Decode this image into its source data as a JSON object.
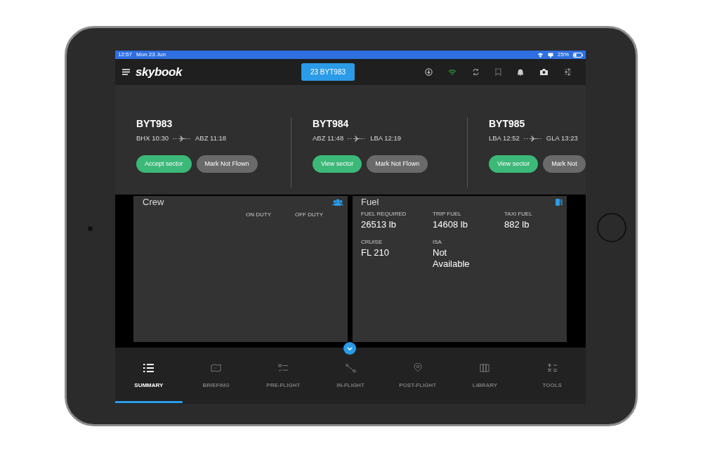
{
  "status_bar": {
    "time": "12:57",
    "date": "Mon 23 Jun",
    "battery": "25%"
  },
  "header": {
    "logo": "skybook",
    "flight_button": "23 BYT983"
  },
  "sectors": [
    {
      "flight": "BYT983",
      "from": "BHX 10:30",
      "to": "ABZ 11:18",
      "primary_button": "Accept sector",
      "secondary_button": "Mark Not Flown"
    },
    {
      "flight": "BYT984",
      "from": "ABZ 11:48",
      "to": "LBA 12:19",
      "primary_button": "View sector",
      "secondary_button": "Mark Not Flown"
    },
    {
      "flight": "BYT985",
      "from": "LBA 12:52",
      "to": "GLA 13:23",
      "primary_button": "View sector",
      "secondary_button": "Mark Not"
    }
  ],
  "crew": {
    "title": "Crew",
    "columns": [
      "ON DUTY",
      "OFF DUTY"
    ]
  },
  "fuel": {
    "title": "Fuel",
    "fields": [
      {
        "label": "FUEL REQUIRED",
        "value": "26513 lb"
      },
      {
        "label": "TRIP FUEL",
        "value": "14608 lb"
      },
      {
        "label": "TAXI FUEL",
        "value": "882 lb"
      },
      {
        "label": "CRUISE",
        "value": "FL 210"
      },
      {
        "label": "ISA",
        "value": "Not Available"
      }
    ]
  },
  "tabs": [
    {
      "label": "SUMMARY",
      "kind": "summary",
      "selected": true
    },
    {
      "label": "BRIEFING",
      "kind": "briefing",
      "selected": false
    },
    {
      "label": "PRE-FLIGHT",
      "kind": "preflight",
      "selected": false
    },
    {
      "label": "IN-FLIGHT",
      "kind": "inflight",
      "selected": false
    },
    {
      "label": "POST-FLIGHT",
      "kind": "postflight",
      "selected": false
    },
    {
      "label": "LIBRARY",
      "kind": "library",
      "selected": false
    },
    {
      "label": "TOOLS",
      "kind": "tools",
      "selected": false
    }
  ]
}
